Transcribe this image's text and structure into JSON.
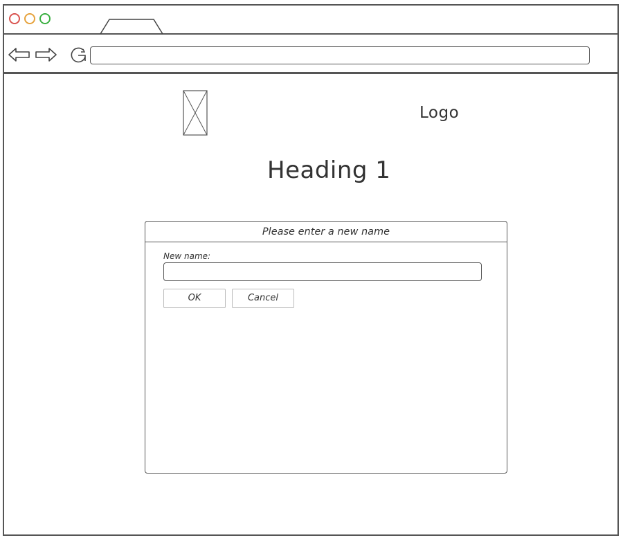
{
  "logo": {
    "text": "Logo"
  },
  "heading": {
    "text": "Heading 1"
  },
  "dialog": {
    "title": "Please enter a new name",
    "field_label": "New name:",
    "field_value": "",
    "ok_label": "OK",
    "cancel_label": "Cancel"
  },
  "browser": {
    "url": "",
    "icons": [
      "close-dot-icon",
      "minimize-dot-icon",
      "maximize-dot-icon",
      "back-arrow-icon",
      "forward-arrow-icon",
      "reload-icon"
    ],
    "dot_colors": {
      "close": "#d9534f",
      "minimize": "#e6a23c",
      "maximize": "#3cb043"
    }
  }
}
